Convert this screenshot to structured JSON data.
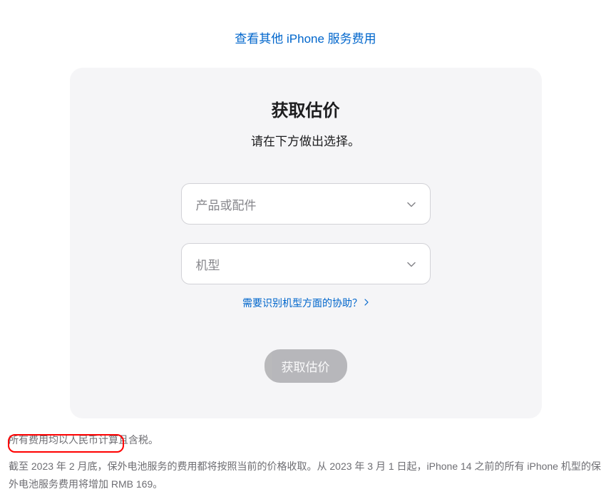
{
  "topLink": {
    "label": "查看其他 iPhone 服务费用"
  },
  "card": {
    "title": "获取估价",
    "subtitle": "请在下方做出选择。",
    "select1": {
      "placeholder": "产品或配件"
    },
    "select2": {
      "placeholder": "机型"
    },
    "helpLink": {
      "label": "需要识别机型方面的协助？"
    },
    "submit": {
      "label": "获取估价"
    }
  },
  "footer": {
    "line1": "所有费用均以人民币计算且含税。",
    "line2": "截至 2023 年 2 月底，保外电池服务的费用都将按照当前的价格收取。从 2023 年 3 月 1 日起，iPhone 14 之前的所有 iPhone 机型的保外电池服务费用将增加 RMB 169。"
  }
}
